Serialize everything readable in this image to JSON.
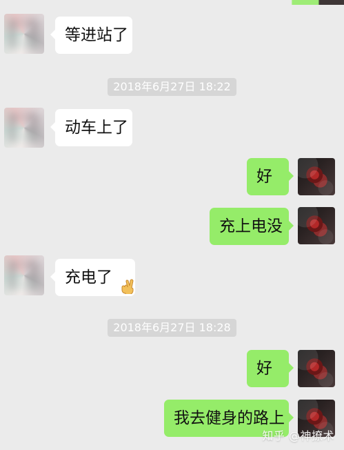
{
  "messages": [
    {
      "text": "等进站了"
    },
    {
      "text": "动车上了"
    },
    {
      "text": "好"
    },
    {
      "text": "充上电没"
    },
    {
      "text": "充电了"
    },
    {
      "text": "好"
    },
    {
      "text": "我去健身的路上"
    }
  ],
  "timestamps": [
    "2018年6月27日 18:22",
    "2018年6月27日 18:28"
  ],
  "watermark": "知乎 @神撩术",
  "colors": {
    "background": "#ebebeb",
    "incoming_bubble": "#ffffff",
    "outgoing_bubble": "#95ec69",
    "timestamp_bg": "#d6d6d6"
  },
  "icons": {
    "victory_emoji": "victory-hand-icon"
  }
}
